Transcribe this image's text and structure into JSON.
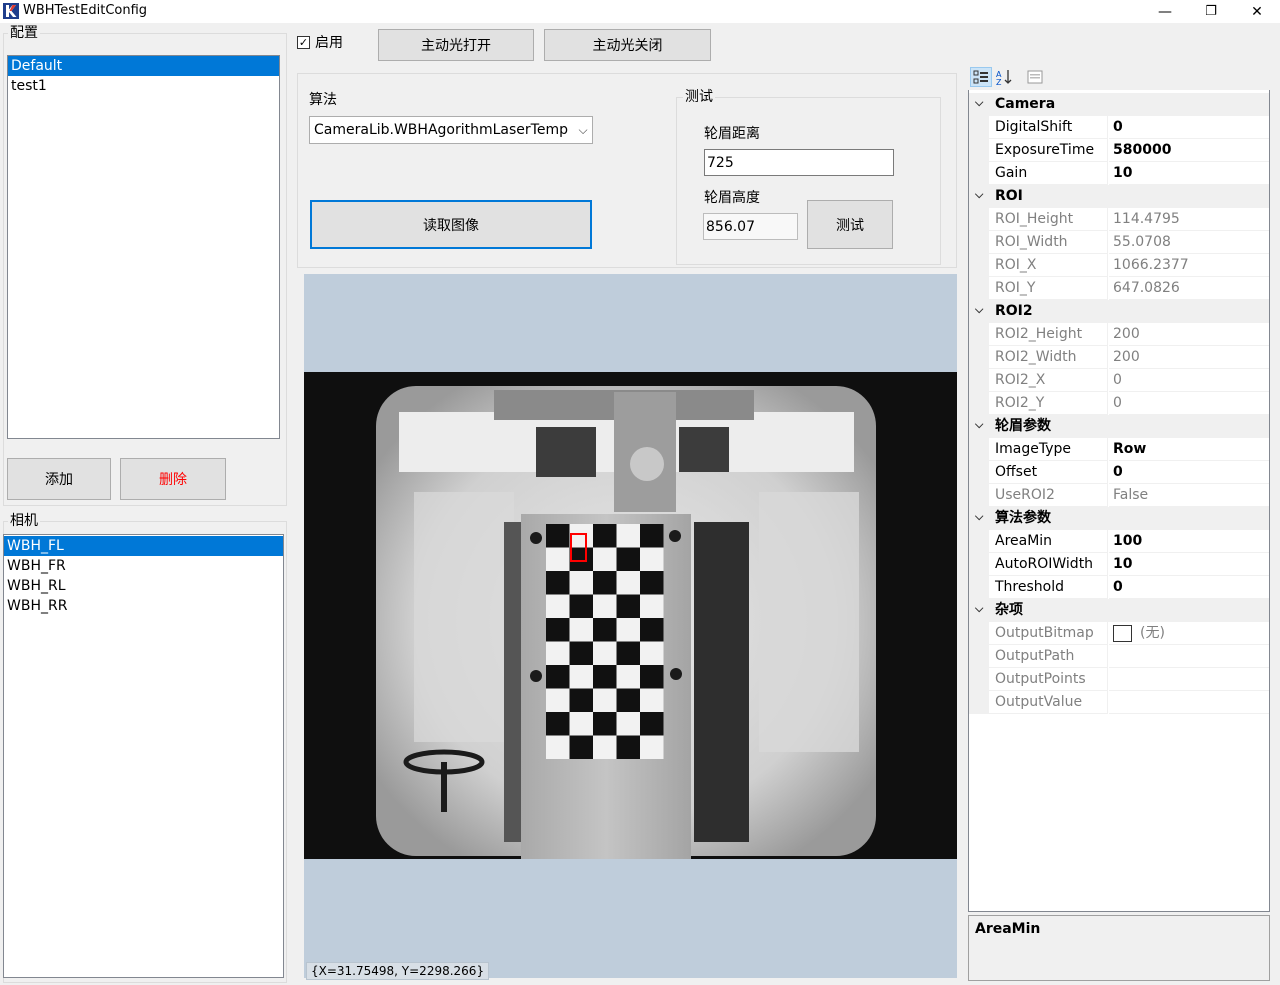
{
  "window": {
    "title": "WBHTestEditConfig",
    "minimize": "—",
    "restore": "❐",
    "close": "✕"
  },
  "config": {
    "label": "配置",
    "items": [
      "Default",
      "test1"
    ],
    "selected_index": 0,
    "add_label": "添加",
    "delete_label": "删除"
  },
  "camera": {
    "label": "相机",
    "items": [
      "WBH_FL",
      "WBH_FR",
      "WBH_RL",
      "WBH_RR"
    ],
    "selected_index": 0
  },
  "top": {
    "enable_label": "启用",
    "enable_checked": true,
    "light_on_label": "主动光打开",
    "light_off_label": "主动光关闭"
  },
  "algo": {
    "label": "算法",
    "selected": "CameraLib.WBHAgorithmLaserTemp",
    "read_image_label": "读取图像"
  },
  "test": {
    "label": "测试",
    "distance_label": "轮眉距离",
    "distance_value": "725",
    "height_label": "轮眉高度",
    "height_value": "856.07",
    "test_button_label": "测试"
  },
  "viewer": {
    "coord_text": "{X=31.75498, Y=2298.266}"
  },
  "property_grid": {
    "categories": [
      {
        "name": "Camera",
        "props": [
          {
            "name": "DigitalShift",
            "value": "0",
            "readonly": false
          },
          {
            "name": "ExposureTime",
            "value": "580000",
            "readonly": false
          },
          {
            "name": "Gain",
            "value": "10",
            "readonly": false
          }
        ]
      },
      {
        "name": "ROI",
        "props": [
          {
            "name": "ROI_Height",
            "value": "114.4795",
            "readonly": true
          },
          {
            "name": "ROI_Width",
            "value": "55.0708",
            "readonly": true
          },
          {
            "name": "ROI_X",
            "value": "1066.2377",
            "readonly": true
          },
          {
            "name": "ROI_Y",
            "value": "647.0826",
            "readonly": true
          }
        ]
      },
      {
        "name": "ROI2",
        "props": [
          {
            "name": "ROI2_Height",
            "value": "200",
            "readonly": true
          },
          {
            "name": "ROI2_Width",
            "value": "200",
            "readonly": true
          },
          {
            "name": "ROI2_X",
            "value": "0",
            "readonly": true
          },
          {
            "name": "ROI2_Y",
            "value": "0",
            "readonly": true
          }
        ]
      },
      {
        "name": "轮眉参数",
        "props": [
          {
            "name": "ImageType",
            "value": "Row",
            "readonly": false
          },
          {
            "name": "Offset",
            "value": "0",
            "readonly": false
          },
          {
            "name": "UseROI2",
            "value": "False",
            "readonly": true
          }
        ]
      },
      {
        "name": "算法参数",
        "props": [
          {
            "name": "AreaMin",
            "value": "100",
            "readonly": false
          },
          {
            "name": "AutoROIWidth",
            "value": "10",
            "readonly": false
          },
          {
            "name": "Threshold",
            "value": "0",
            "readonly": false
          }
        ]
      },
      {
        "name": "杂项",
        "props": [
          {
            "name": "OutputBitmap",
            "value": "(无)",
            "readonly": true,
            "swatch": true
          },
          {
            "name": "OutputPath",
            "value": "",
            "readonly": true
          },
          {
            "name": "OutputPoints",
            "value": "",
            "readonly": true
          },
          {
            "name": "OutputValue",
            "value": "",
            "readonly": true
          }
        ]
      }
    ],
    "description_title": "AreaMin"
  },
  "colors": {
    "accent": "#0078d7",
    "viewer_bg": "#bfcddb",
    "delete_text": "#ff0000"
  }
}
